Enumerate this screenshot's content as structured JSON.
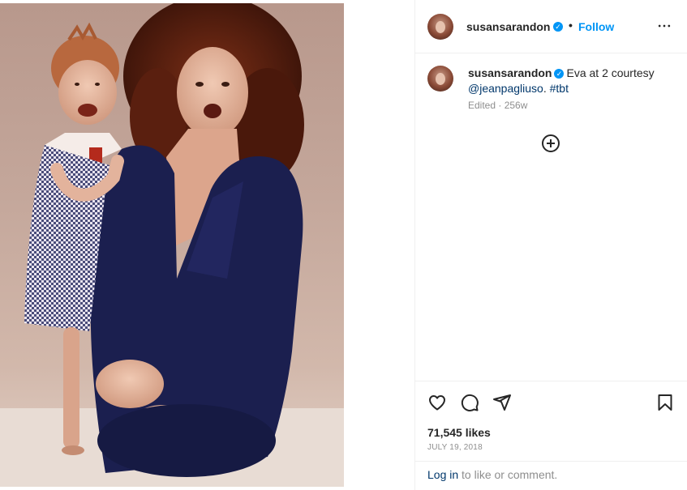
{
  "post": {
    "photo_alt": "",
    "author": {
      "username": "susansarandon",
      "verified_mark": "✓",
      "separator": "•",
      "follow_label": "Follow"
    },
    "caption": {
      "username": "susansarandon",
      "text_part1": "Eva at 2 courtesy",
      "mention": "@jeanpagliuso",
      "text_part2": ". ",
      "hashtag": "#tbt",
      "meta": "Edited · 256w"
    },
    "likes": "71,545 likes",
    "date": "JULY 19, 2018",
    "login": {
      "link_label": "Log in",
      "suffix": " to like or comment."
    },
    "icons": {
      "more": "more-options-icon",
      "add_comment": "add-comment-icon",
      "like": "heart-icon",
      "comment": "comment-icon",
      "share": "share-icon",
      "save": "bookmark-icon"
    },
    "colors": {
      "accent": "#0095f6",
      "text": "#262626",
      "muted": "#8e8e8e",
      "link": "#00376b",
      "border": "#efefef"
    }
  }
}
